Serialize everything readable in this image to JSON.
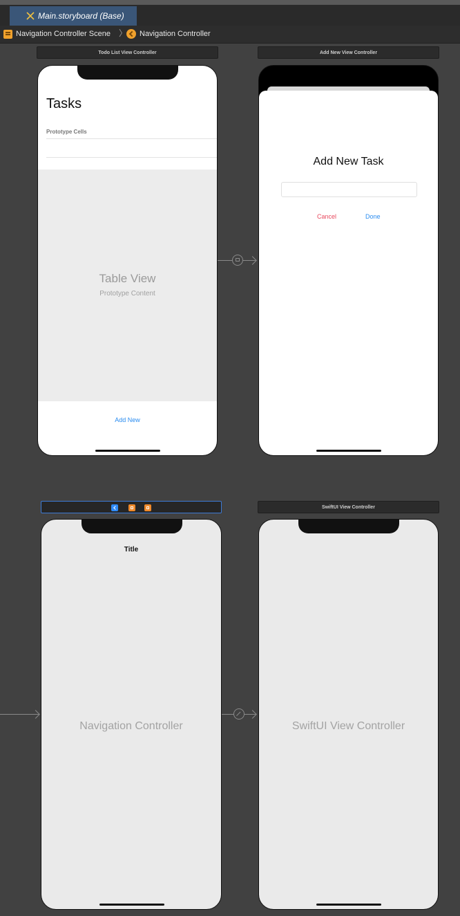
{
  "tabbar": {
    "active_tab": "Main.storyboard (Base)",
    "tab_icon": "storyboard-icon"
  },
  "breadcrumb": {
    "scene": "Navigation Controller Scene",
    "separator": "〉",
    "item": "Navigation Controller"
  },
  "scenes": {
    "todo": {
      "bar_title": "Todo List View Controller",
      "nav_title": "Tasks",
      "prototype_label": "Prototype Cells",
      "table_title": "Table View",
      "table_subtitle": "Prototype Content",
      "add_button": "Add New"
    },
    "add_new": {
      "bar_title": "Add New View Controller",
      "heading": "Add New Task",
      "field_value": "",
      "cancel": "Cancel",
      "done": "Done"
    },
    "navigation": {
      "nav_title": "Title",
      "label": "Navigation Controller"
    },
    "swiftui": {
      "bar_title": "SwiftUI View Controller",
      "label": "SwiftUI View Controller"
    }
  },
  "colors": {
    "accent_blue": "#2a8cf0",
    "cancel_red": "#e8485d",
    "scene_orange": "#f0a12c",
    "tab_blue": "#3a5678"
  }
}
